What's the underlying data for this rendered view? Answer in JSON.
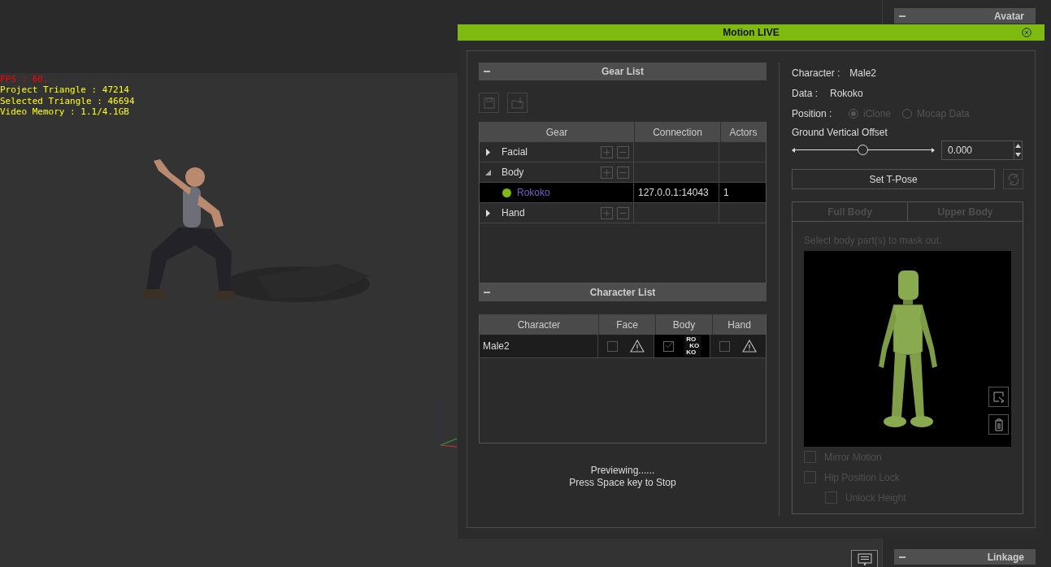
{
  "viewport_stats": [
    {
      "text": "FPS : 60.",
      "color": "#ff0000"
    },
    {
      "text": "Project Triangle : 47214",
      "color": "#ffff00"
    },
    {
      "text": "Selected Triangle : 46694",
      "color": "#ffff00"
    },
    {
      "text": "Video Memory : 1.1/4.1GB",
      "color": "#ffff00"
    }
  ],
  "side_panels": [
    {
      "title": "Avatar"
    },
    {
      "title": "Linkage"
    }
  ],
  "dialog": {
    "title": "Motion LIVE",
    "gear_list": {
      "title": "Gear List",
      "columns": [
        "Gear",
        "Connection",
        "Actors"
      ],
      "rows": [
        {
          "name": "Facial",
          "expanded": false,
          "selected": false
        },
        {
          "name": "Body",
          "expanded": true,
          "selected": false,
          "children": [
            {
              "name": "Rokoko",
              "connection": "127.0.0.1:14043",
              "actors": "1",
              "connected": true,
              "selected": true
            }
          ]
        },
        {
          "name": "Hand",
          "expanded": false,
          "selected": false
        }
      ]
    },
    "character_list": {
      "title": "Character List",
      "columns": [
        "Character",
        "Face",
        "Body",
        "Hand"
      ],
      "rows": [
        {
          "cells": [
            {
              "kind": "text",
              "text": "Male2"
            },
            {
              "checked": false,
              "kind": "warning"
            },
            {
              "checked": true,
              "kind": "logo",
              "logo": [
                "RO",
                "KO",
                "KO"
              ]
            },
            {
              "checked": false,
              "kind": "warning"
            }
          ]
        }
      ]
    },
    "status": [
      "Previewing......",
      "Press Space key to Stop"
    ],
    "info": [
      {
        "label": "Character :",
        "value": "Male2"
      },
      {
        "label": "Data :",
        "value": "Rokoko"
      }
    ],
    "position": {
      "label": "Position :",
      "disabled": true,
      "options": [
        {
          "label": "iClone",
          "selected": true
        },
        {
          "label": "Mocap Data",
          "selected": false
        }
      ]
    },
    "ground_offset": {
      "label": "Ground Vertical Offset",
      "level": 0.5,
      "value": "0.000"
    },
    "tpose_button": "Set T-Pose",
    "mask": {
      "disabled": true,
      "tabs": [
        {
          "label": "Full Body",
          "selected": false
        },
        {
          "label": "Upper Body",
          "selected": false
        }
      ],
      "hint": "Select body part(s) to mask out.",
      "options": [
        {
          "label": "Mirror Motion",
          "checked": false
        },
        {
          "label": "Hip Position Lock",
          "checked": false,
          "children": [
            {
              "label": "Unlock Height",
              "checked": false
            }
          ]
        }
      ]
    }
  }
}
